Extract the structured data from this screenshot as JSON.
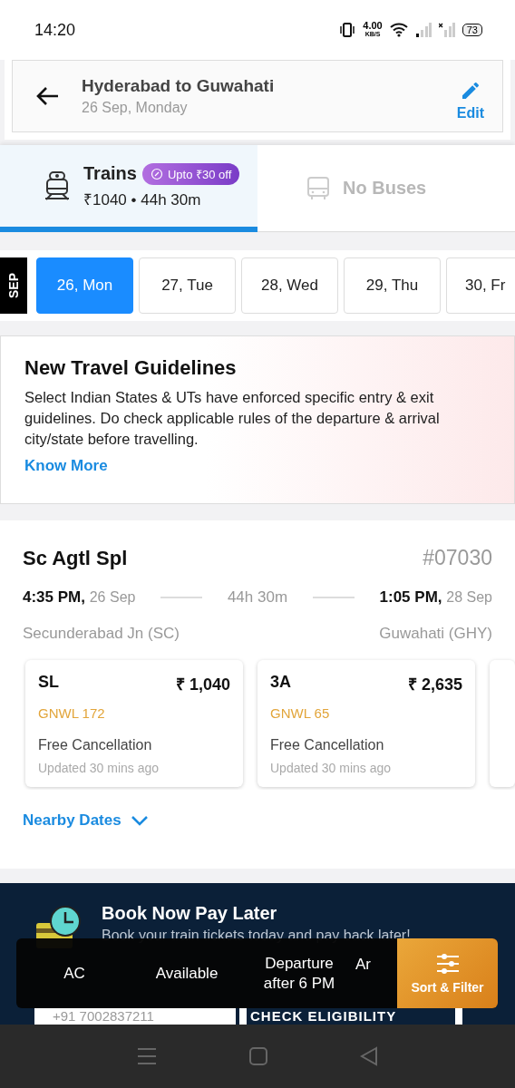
{
  "status_bar": {
    "time": "14:20",
    "net_speed": "4.00",
    "net_unit": "KB/S",
    "battery": "73"
  },
  "header": {
    "title": "Hyderabad to Guwahati",
    "subtitle": "26 Sep, Monday",
    "edit_label": "Edit"
  },
  "mode_tabs": [
    {
      "kind": "train",
      "label": "Trains",
      "offer": "Upto ₹30 off",
      "detail": "₹1040 • 44h 30m",
      "selected": true,
      "disabled": false
    },
    {
      "kind": "bus",
      "label": "No Buses",
      "selected": false,
      "disabled": true
    }
  ],
  "date_strip": {
    "month": "SEP",
    "dates": [
      {
        "label": "26, Mon",
        "selected": true
      },
      {
        "label": "27, Tue",
        "selected": false
      },
      {
        "label": "28, Wed",
        "selected": false
      },
      {
        "label": "29, Thu",
        "selected": false
      },
      {
        "label": "30, Fr",
        "selected": false
      }
    ]
  },
  "guidelines": {
    "title": "New Travel Guidelines",
    "text": "Select Indian States & UTs have enforced specific entry & exit guidelines. Do check applicable rules of the departure & arrival city/state before travelling.",
    "link": "Know More"
  },
  "train": {
    "name": "Sc Agtl Spl",
    "number": "#07030",
    "departure_time": "4:35 PM,",
    "departure_date": "26 Sep",
    "duration": "44h 30m",
    "arrival_time": "1:05 PM,",
    "arrival_date": "28 Sep",
    "from_station": "Secunderabad Jn (SC)",
    "to_station": "Guwahati (GHY)",
    "classes": [
      {
        "class": "SL",
        "fare": "₹ 1,040",
        "availability": "GNWL 172",
        "cancellation": "Free Cancellation",
        "updated": "Updated 30 mins ago"
      },
      {
        "class": "3A",
        "fare": "₹ 2,635",
        "availability": "GNWL 65",
        "cancellation": "Free Cancellation",
        "updated": "Updated 30 mins ago"
      }
    ],
    "nearby_dates": "Nearby Dates"
  },
  "promo_banner": {
    "title": "Book Now Pay Later",
    "subtitle": "Book your train tickets today and pay back later!",
    "phone": "+91 7002837211",
    "button": "CHECK ELIGIBILITY"
  },
  "filter_bar": {
    "chips": [
      "AC",
      "Available",
      "Departure after 6 PM",
      "Ar"
    ],
    "sort_filter": "Sort & Filter"
  }
}
